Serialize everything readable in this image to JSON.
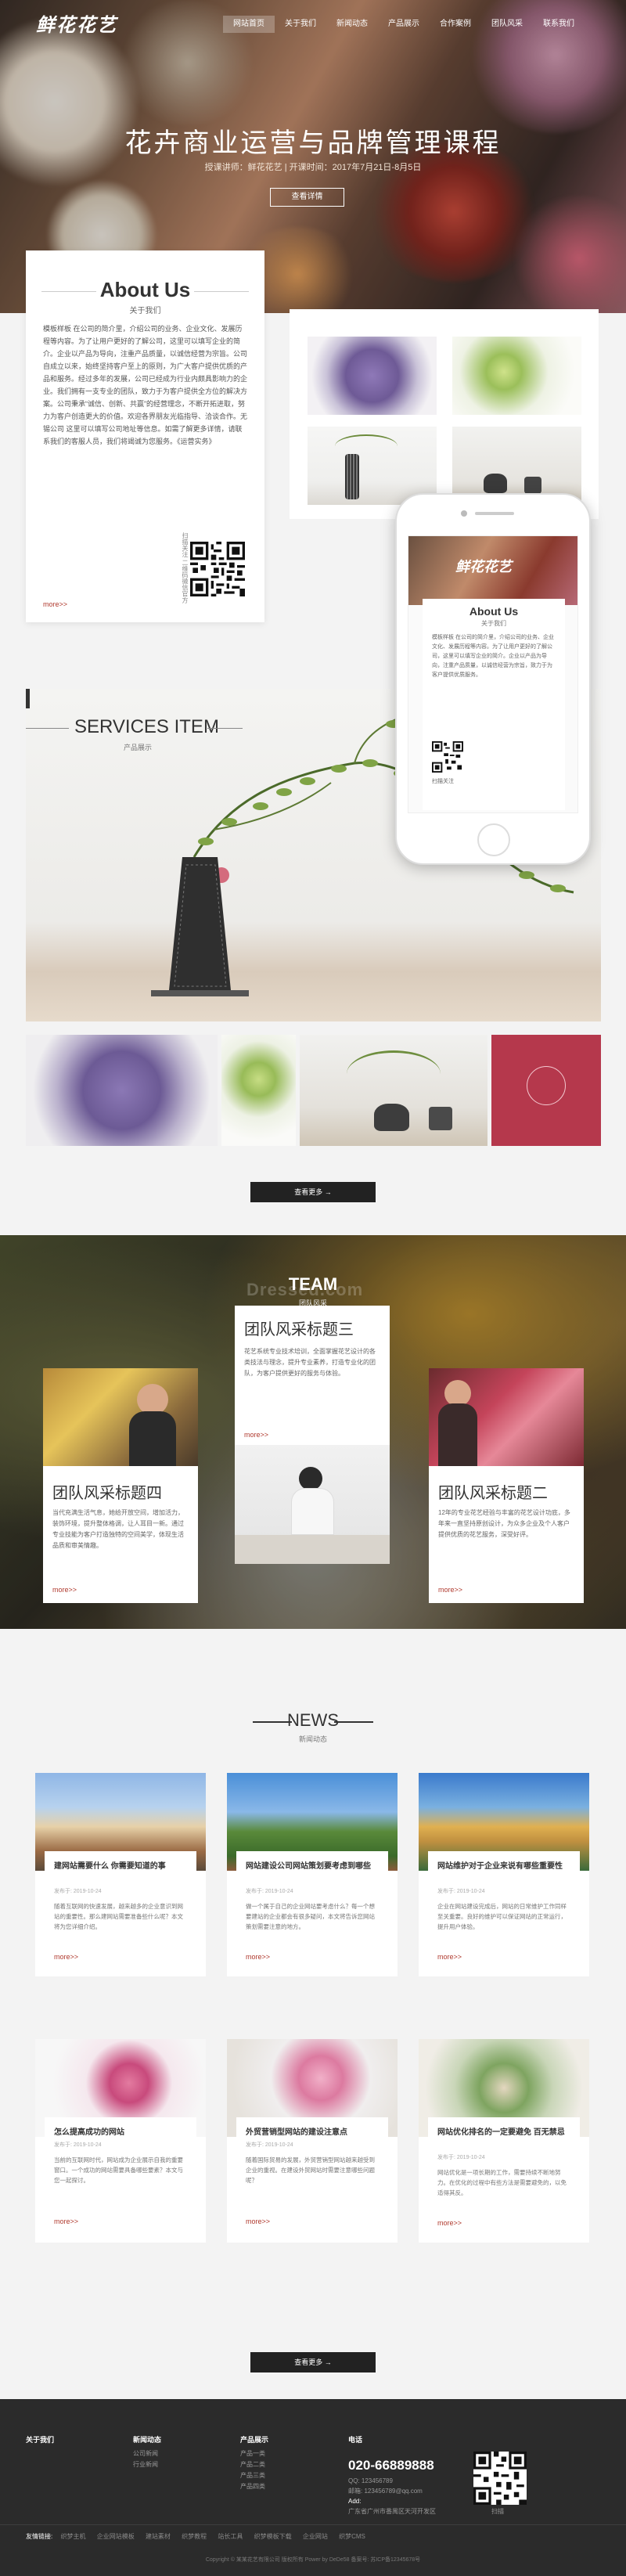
{
  "header": {
    "logo": "鲜花花艺",
    "nav": [
      "网站首页",
      "关于我们",
      "新闻动态",
      "产品展示",
      "合作案例",
      "团队风采",
      "联系我们"
    ],
    "active_nav": 0
  },
  "hero": {
    "title": "花卉商业运营与品牌管理课程",
    "subtitle": "授课讲师：鲜花花艺 | 开课时间：2017年7月21日-8月5日",
    "button": "查看详情"
  },
  "about": {
    "title": "About Us",
    "subtitle": "关于我们",
    "text": "模板样板 在公司的简介里，介绍公司的业务、企业文化、发展历程等内容。为了让用户更好的了解公司，这里可以填写企业的简介。企业以产品为导向，注重产品质量，以诚信经营为宗旨。公司自成立以来，始终坚持客户至上的原则，为广大客户提供优质的产品和服务。经过多年的发展，公司已经成为行业内颇具影响力的企业。我们拥有一支专业的团队，致力于为客户提供全方位的解决方案。公司秉承“诚信、创新、共赢”的经营理念，不断开拓进取，努力为客户创造更大的价值。欢迎各界朋友光临指导、洽谈合作。无锡公司 这里可以填写公司地址等信息。如需了解更多详情，请联系我们的客服人员，我们将竭诚为您服务。《运营实务》",
    "scan_text": "扫描关注 二维码微信官方",
    "more": "more>>"
  },
  "phone": {
    "logo": "鲜花花艺",
    "about_title": "About Us",
    "about_sub": "关于我们",
    "text": "模板样板 在公司的简介里，介绍公司的业务、企业文化、发展历程等内容。为了让用户更好的了解公司，这里可以填写企业的简介。企业以产品为导向，注重产品质量，以诚信经营为宗旨，致力于为客户提供优质服务。",
    "scan": "扫描关注"
  },
  "services": {
    "title": "SERVICES ITEM",
    "subtitle": "产品展示",
    "button": "查看更多 →"
  },
  "team": {
    "title": "TEAM",
    "subtitle": "团队风采",
    "watermark": "Dressed.com",
    "cards": [
      {
        "title": "团队风采标题四",
        "text": "当代充满生活气息，她给开放空间，增加活力，装饰环境，提升整体格调，让人耳目一新。通过专业技能为客户打造独特的空间美学，体现生活品质和审美情趣。",
        "more": "more>>"
      },
      {
        "title": "团队风采标题三",
        "text": "花艺系统专业技术培训，全面掌握花艺设计的各类技法与理念，提升专业素养，打造专业化的团队，为客户提供更好的服务与体验。",
        "more": "more>>"
      },
      {
        "title": "团队风采标题二",
        "text": "12年的专业花艺经验与丰富的花艺设计功底，多年来一直坚持原创设计，为众多企业及个人客户提供优质的花艺服务，深受好评。",
        "more": "more>>"
      }
    ]
  },
  "news": {
    "title": "NEWS",
    "subtitle": "新闻动态",
    "button": "查看更多 →",
    "items": [
      {
        "title": "建网站需要什么 你需要知道的事",
        "date": "发布于: 2019-10-24",
        "text": "随着互联网的快速发展，越来越多的企业意识到网站的重要性。那么建网站需要准备些什么呢？本文将为您详细介绍。",
        "more": "more>>"
      },
      {
        "title": "网站建设公司网站策划要考虑到哪些",
        "date": "发布于: 2019-10-24",
        "text": "做一个属于自己的企业网站要考虑什么？每一个想要建站的企业都会有很多疑问，本文将告诉您网站策划需要注意的地方。",
        "more": "more>>"
      },
      {
        "title": "网站维护对于企业来说有哪些重要性",
        "date": "发布于: 2019-10-24",
        "text": "企业在网站建设完成后，网站的日常维护工作同样至关重要。良好的维护可以保证网站的正常运行，提升用户体验。",
        "more": "more>>"
      },
      {
        "title": "怎么提高成功的网站",
        "date": "发布于: 2019-10-24",
        "text": "当前的互联网时代，网站成为企业展示自我的重要窗口。一个成功的网站需要具备哪些要素？本文与您一起探讨。",
        "more": "more>>"
      },
      {
        "title": "外贸营销型网站的建设注意点",
        "date": "发布于: 2019-10-24",
        "text": "随着国际贸易的发展，外贸营销型网站越来越受到企业的重视。在建设外贸网站时需要注意哪些问题呢？",
        "more": "more>>"
      },
      {
        "title": "网站优化排名的一定要避免 百无禁忌",
        "date": "发布于: 2019-10-24",
        "text": "网站优化是一项长期的工作，需要持续不断地努力。在优化的过程中有些方法是需要避免的，以免适得其反。",
        "more": "more>>"
      }
    ]
  },
  "footer": {
    "col1_title": "关于我们",
    "col2_title": "新闻动态",
    "col2_items": [
      "公司新闻",
      "行业新闻"
    ],
    "col3_title": "产品展示",
    "col3_items": [
      "产品一类",
      "产品二类",
      "产品三类",
      "产品四类"
    ],
    "col4_title": "电话",
    "phone": "020-66889888",
    "contact_lines": [
      "QQ: 123456789",
      "邮箱: 123456789@qq.com"
    ],
    "addr_label": "Add:",
    "addr": "广东省广州市番禺区天河开发区",
    "qr_label": "扫描",
    "links_label": "友情链接:",
    "links": [
      "织梦主机",
      "企业网站模板",
      "建站素材",
      "织梦教程",
      "站长工具",
      "织梦模板下载",
      "企业网站",
      "织梦CMS"
    ],
    "copyright": "Copyright © 某某花艺有限公司 版权所有 Power by DeDe58 备案号: 苏ICP备12345678号"
  }
}
